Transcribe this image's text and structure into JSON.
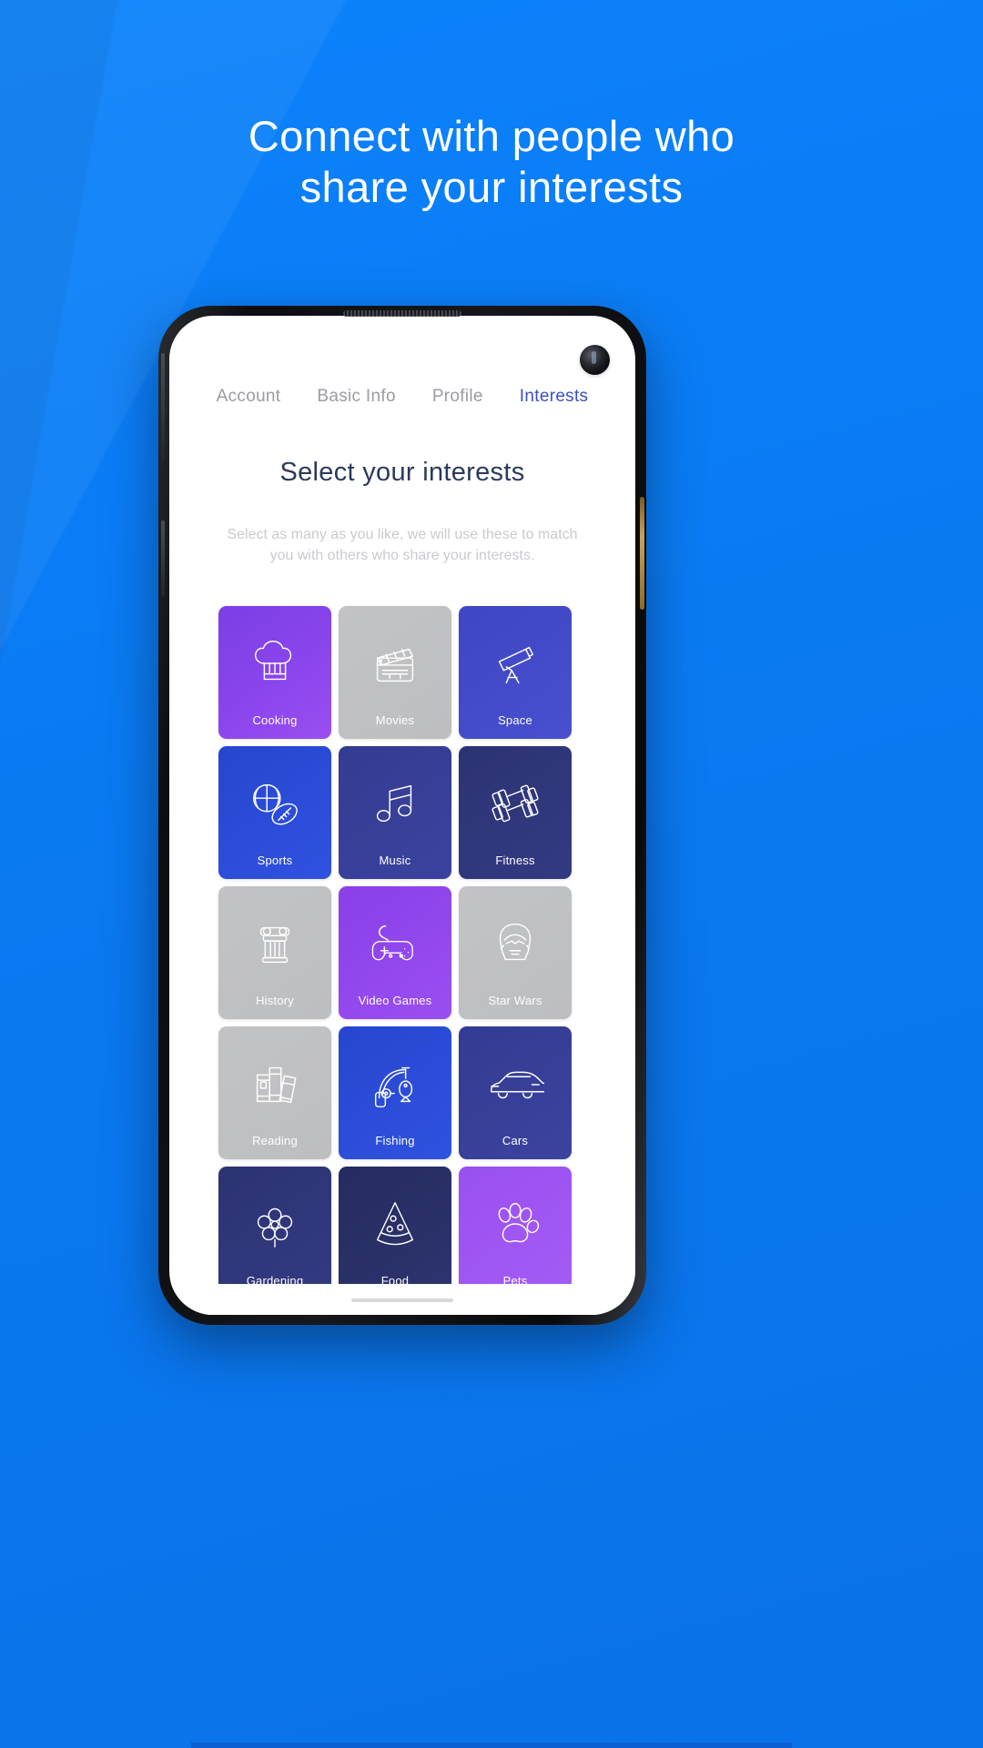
{
  "promo": {
    "headline_line1": "Connect with people who",
    "headline_line2": "share your interests",
    "background_color": "#0a7cf5",
    "headline_color": "#ffffff"
  },
  "app": {
    "tabs": [
      {
        "label": "Account",
        "active": false
      },
      {
        "label": "Basic Info",
        "active": false
      },
      {
        "label": "Profile",
        "active": false
      },
      {
        "label": "Interests",
        "active": true
      }
    ],
    "active_tab_color": "#3b4fc4",
    "inactive_tab_color": "#9a9ca1",
    "page_title": "Select your interests",
    "page_subtitle": "Select as many as you like, we will use these to match you with others who share your interests.",
    "interests": [
      {
        "label": "Cooking",
        "icon": "chef-hat-icon",
        "color": "#8a45ec",
        "theme": "c-purple"
      },
      {
        "label": "Movies",
        "icon": "clapperboard-icon",
        "color": "#c2c3c5",
        "theme": "c-gray"
      },
      {
        "label": "Space",
        "icon": "telescope-icon",
        "color": "#4850cf",
        "theme": "c-indigo"
      },
      {
        "label": "Sports",
        "icon": "sports-balls-icon",
        "color": "#2f52e0",
        "theme": "c-blue"
      },
      {
        "label": "Music",
        "icon": "music-note-icon",
        "color": "#3b439f",
        "theme": "c-navy"
      },
      {
        "label": "Fitness",
        "icon": "dumbbell-icon",
        "color": "#333a82",
        "theme": "c-deep"
      },
      {
        "label": "History",
        "icon": "column-icon",
        "color": "#c2c3c5",
        "theme": "c-gray"
      },
      {
        "label": "Video Games",
        "icon": "gamepad-icon",
        "color": "#9a4ff2",
        "theme": "c-vpurple"
      },
      {
        "label": "Star Wars",
        "icon": "darth-vader-icon",
        "color": "#c2c3c5",
        "theme": "c-gray"
      },
      {
        "label": "Reading",
        "icon": "books-icon",
        "color": "#c2c3c5",
        "theme": "c-gray"
      },
      {
        "label": "Fishing",
        "icon": "fishing-rod-icon",
        "color": "#2f52e0",
        "theme": "c-blue"
      },
      {
        "label": "Cars",
        "icon": "car-icon",
        "color": "#3b439f",
        "theme": "c-navy"
      },
      {
        "label": "Gardening",
        "icon": "flower-icon",
        "color": "#333a82",
        "theme": "c-deep"
      },
      {
        "label": "Food",
        "icon": "pizza-slice-icon",
        "color": "#2d3470",
        "theme": "c-dnavy"
      },
      {
        "label": "Pets",
        "icon": "paw-print-icon",
        "color": "#a55cf5",
        "theme": "c-lpurple"
      }
    ]
  }
}
